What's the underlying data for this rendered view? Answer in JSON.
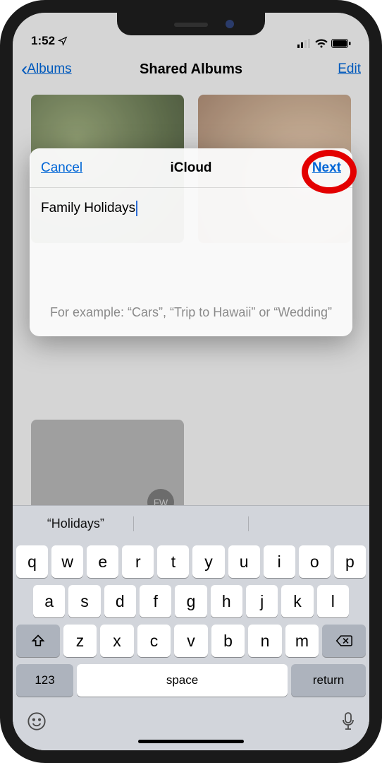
{
  "status": {
    "time": "1:52"
  },
  "nav": {
    "back": "Albums",
    "title": "Shared Albums",
    "edit": "Edit"
  },
  "sheet": {
    "cancel": "Cancel",
    "title": "iCloud",
    "next": "Next",
    "input_value": "Family Holidays",
    "hint": "For example: “Cars”, “Trip to Hawaii” or “Wedding”"
  },
  "albums": {
    "badge": "FW"
  },
  "keyboard": {
    "suggestion": "“Holidays”",
    "row1": [
      "q",
      "w",
      "e",
      "r",
      "t",
      "y",
      "u",
      "i",
      "o",
      "p"
    ],
    "row2": [
      "a",
      "s",
      "d",
      "f",
      "g",
      "h",
      "j",
      "k",
      "l"
    ],
    "row3": [
      "z",
      "x",
      "c",
      "v",
      "b",
      "n",
      "m"
    ],
    "key_123": "123",
    "key_space": "space",
    "key_return": "return"
  }
}
